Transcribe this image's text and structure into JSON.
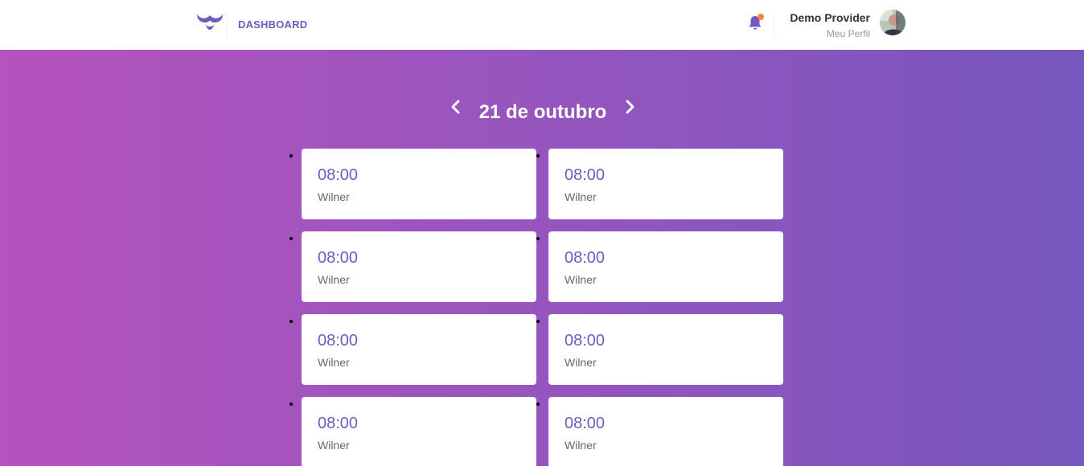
{
  "header": {
    "nav_label": "DASHBOARD",
    "logo_icon": "mustache-logo-icon",
    "notification_icon": "bell-icon",
    "user_name": "Demo Provider",
    "profile_link": "Meu Perfil",
    "accent_color": "#7159c1",
    "notification_dot_color": "#ff892e"
  },
  "schedule": {
    "date_label": "21 de outubro",
    "prev_icon": "chevron-left-icon",
    "next_icon": "chevron-right-icon",
    "appointments": [
      {
        "time": "08:00",
        "name": "Wilner"
      },
      {
        "time": "08:00",
        "name": "Wilner"
      },
      {
        "time": "08:00",
        "name": "Wilner"
      },
      {
        "time": "08:00",
        "name": "Wilner"
      },
      {
        "time": "08:00",
        "name": "Wilner"
      },
      {
        "time": "08:00",
        "name": "Wilner"
      },
      {
        "time": "08:00",
        "name": "Wilner"
      },
      {
        "time": "08:00",
        "name": "Wilner"
      }
    ]
  }
}
